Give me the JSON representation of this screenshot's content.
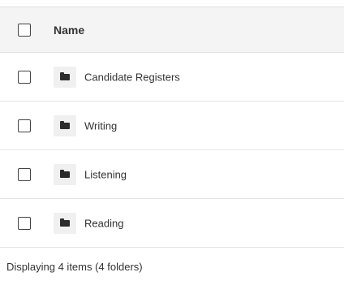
{
  "table": {
    "header": {
      "name_label": "Name"
    },
    "rows": [
      {
        "name": "Candidate Registers",
        "type": "folder"
      },
      {
        "name": "Writing",
        "type": "folder"
      },
      {
        "name": "Listening",
        "type": "folder"
      },
      {
        "name": "Reading",
        "type": "folder"
      }
    ]
  },
  "footer": {
    "status": "Displaying 4 items (4 folders)"
  },
  "icons": {
    "row_icon": "folder-icon"
  }
}
